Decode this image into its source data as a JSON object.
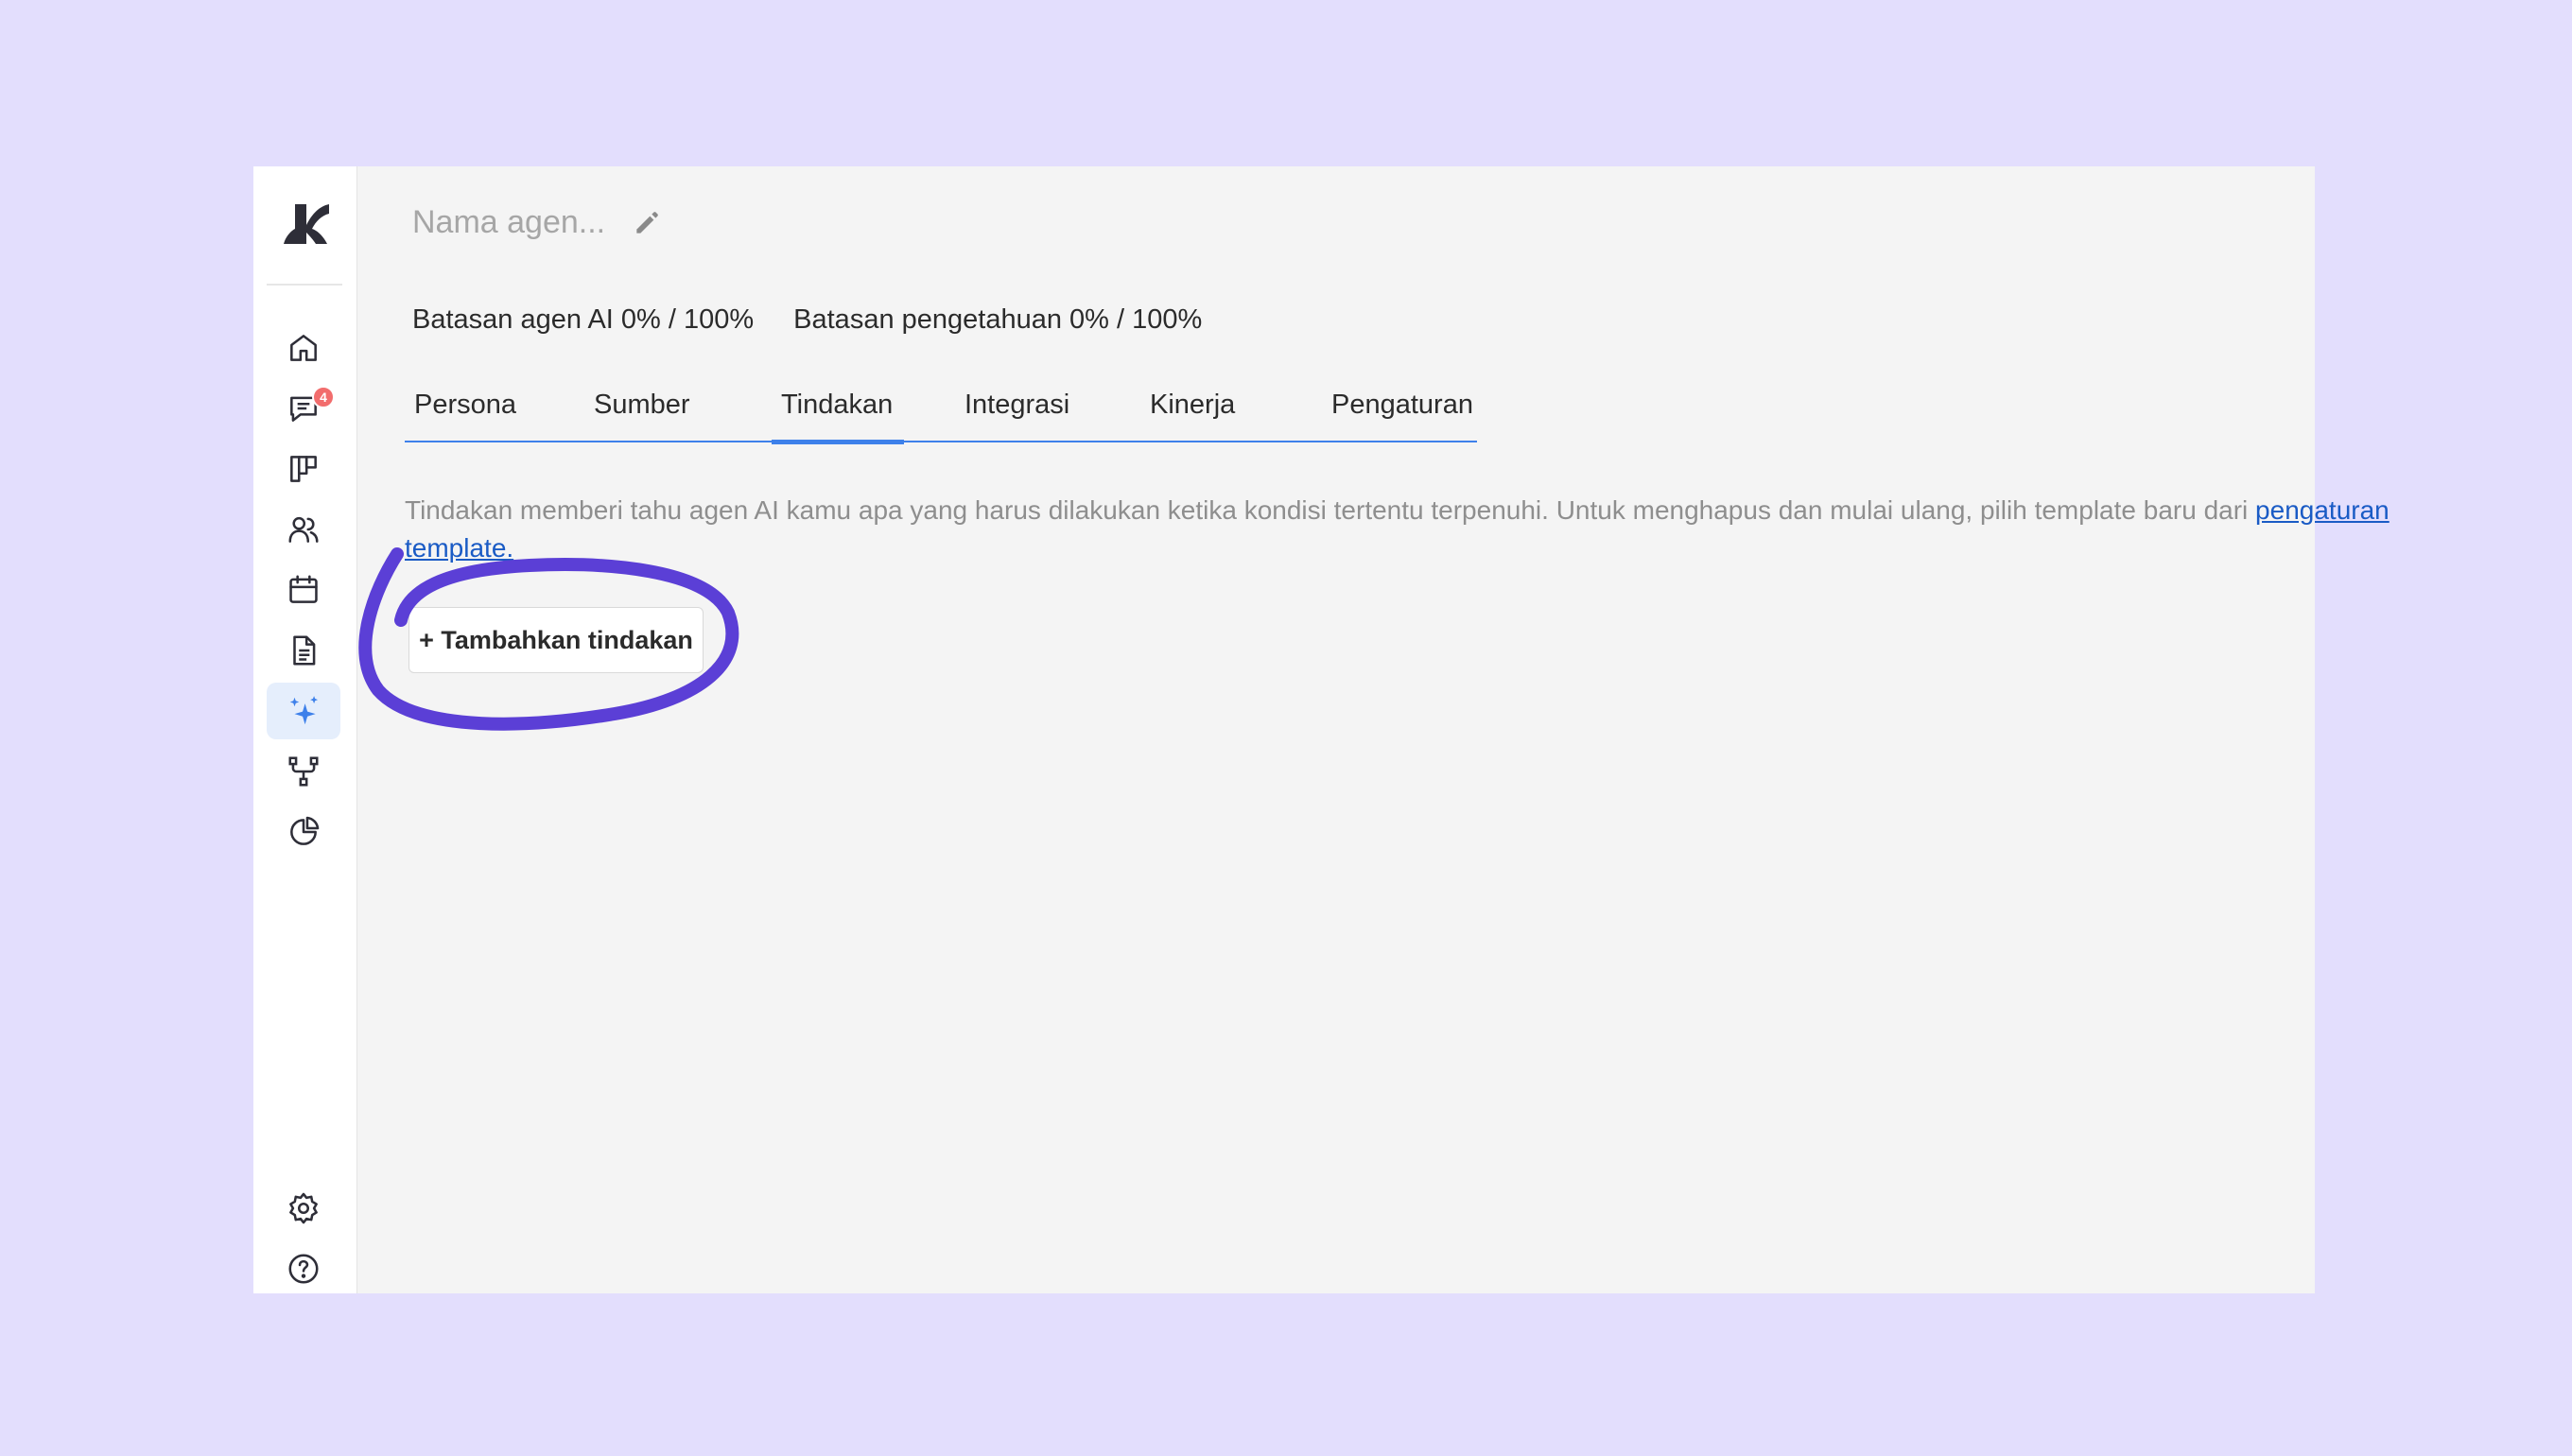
{
  "app": {
    "brand_color": "#3d80ea",
    "annotation_color": "#5b3fd6"
  },
  "sidebar": {
    "logo": "kommo-logo",
    "items": [
      {
        "icon": "home-icon"
      },
      {
        "icon": "chat-icon",
        "badge": "4"
      },
      {
        "icon": "board-icon"
      },
      {
        "icon": "contacts-icon"
      },
      {
        "icon": "calendar-icon"
      },
      {
        "icon": "document-icon"
      },
      {
        "icon": "sparkles-icon",
        "active": true
      },
      {
        "icon": "flow-icon"
      },
      {
        "icon": "stats-icon"
      }
    ],
    "bottom_items": [
      {
        "icon": "gear-icon"
      },
      {
        "icon": "help-icon"
      }
    ]
  },
  "header": {
    "agent_name_placeholder": "Nama agen..."
  },
  "limits": {
    "ai_agent": "Batasan agen AI 0% / 100%",
    "knowledge": "Batasan pengetahuan 0% / 100%"
  },
  "tabs": [
    {
      "label": "Persona"
    },
    {
      "label": "Sumber"
    },
    {
      "label": "Tindakan",
      "active": true
    },
    {
      "label": "Integrasi"
    },
    {
      "label": "Kinerja"
    },
    {
      "label": "Pengaturan"
    }
  ],
  "actions": {
    "description": "Tindakan memberi tahu agen AI kamu apa yang harus dilakukan ketika kondisi tertentu terpenuhi. Untuk menghapus dan mulai ulang, pilih template baru dari",
    "link_text": "pengaturan template.",
    "add_button_label": "+ Tambahkan tindakan"
  }
}
